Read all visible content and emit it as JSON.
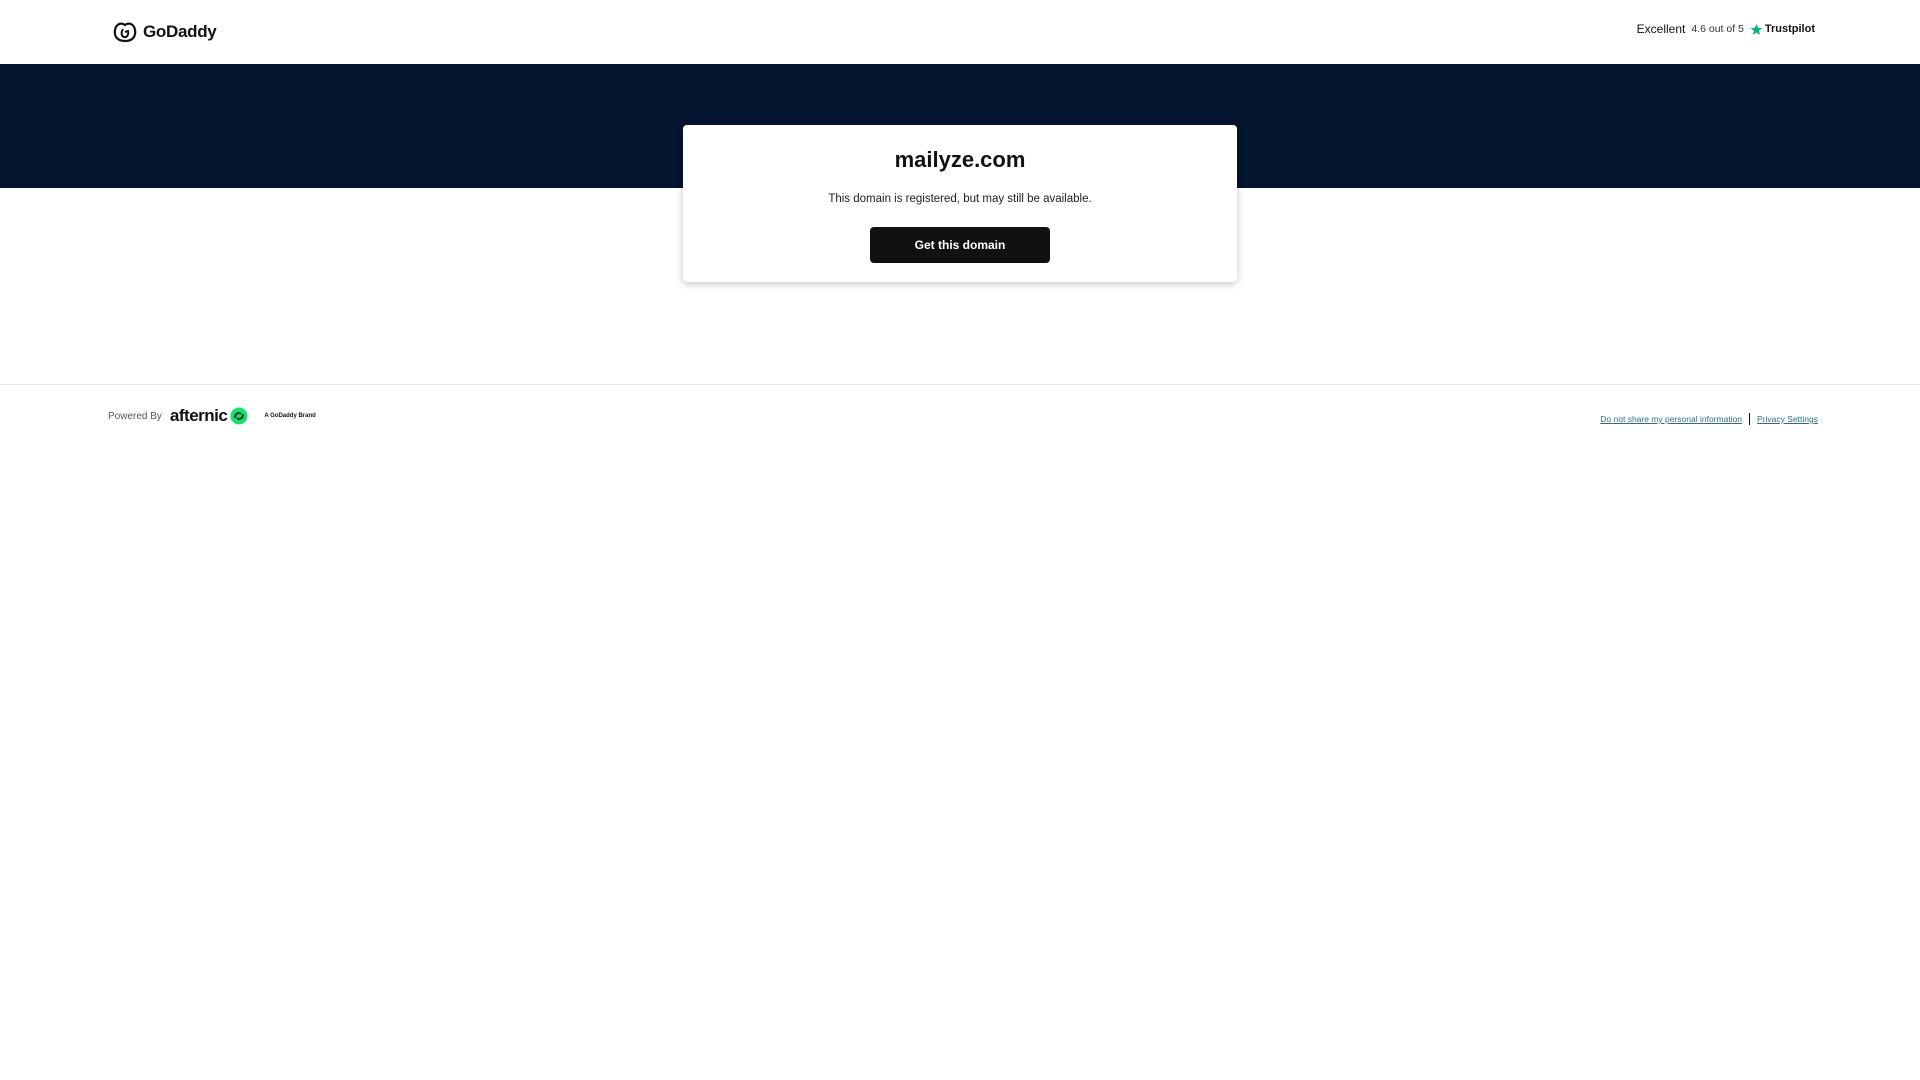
{
  "header": {
    "logo_text": "GoDaddy",
    "rating_word": "Excellent",
    "rating_score": "4.6 out of 5",
    "trustpilot_label": "Trustpilot",
    "star_color": "#00b67a"
  },
  "banner": {
    "color": "#05142e"
  },
  "card": {
    "domain": "mailyze.com",
    "subtitle": "This domain is registered, but may still be available.",
    "cta_label": "Get this domain"
  },
  "footer": {
    "powered_by": "Powered By",
    "afternic_text": "afternic",
    "brand_text": "A GoDaddy Brand",
    "afternic_icon_color": "#19e06a",
    "links": [
      "Do not share my personal information",
      "Privacy Settings"
    ]
  }
}
